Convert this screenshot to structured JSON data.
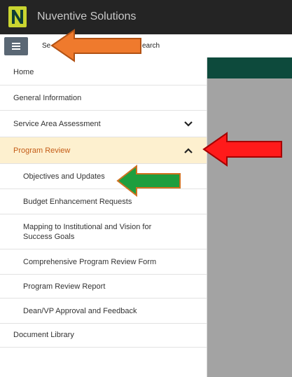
{
  "app": {
    "title": "Nuventive Solutions"
  },
  "search": {
    "text_left": "Se",
    "text_right": "earch"
  },
  "sidebar": {
    "items": [
      {
        "label": "Home"
      },
      {
        "label": "General Information"
      },
      {
        "label": "Service Area Assessment"
      },
      {
        "label": "Program Review"
      },
      {
        "label": "Objectives and Updates"
      },
      {
        "label": "Budget Enhancement Requests"
      },
      {
        "label": "Mapping to Institutional and Vision for Success Goals"
      },
      {
        "label": "Comprehensive Program Review Form"
      },
      {
        "label": "Program Review Report"
      },
      {
        "label": "Dean/VP Approval and Feedback"
      },
      {
        "label": "Document Library"
      }
    ]
  },
  "colors": {
    "topbar": "#242424",
    "active_bg": "#fdf0cf",
    "active_text": "#c45c17",
    "green_band": "#0d4a3c",
    "annotation_orange": "#ef7a2d",
    "annotation_red": "#ff1a1a",
    "annotation_green": "#1e9e3e"
  }
}
